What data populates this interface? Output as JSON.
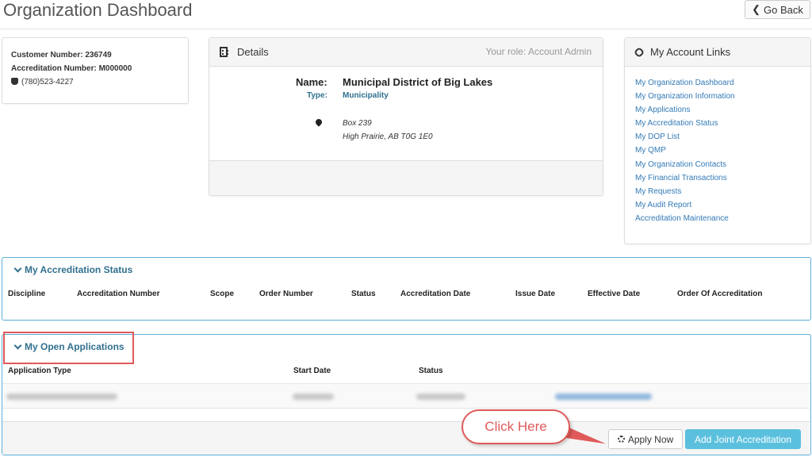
{
  "page": {
    "title": "Organization Dashboard",
    "back_label": "Go Back"
  },
  "customer": {
    "customer_number_label": "Customer Number:",
    "customer_number": "236749",
    "accreditation_number_label": "Accreditation Number:",
    "accreditation_number": "M000000",
    "phone": "(780)523-4227"
  },
  "details": {
    "header": "Details",
    "role": "Your role: Account Admin",
    "name_label": "Name:",
    "name": "Municipal District of Big Lakes",
    "type_label": "Type:",
    "type": "Municipality",
    "address_line1": "Box 239",
    "address_line2": "High Prairie, AB T0G 1E0"
  },
  "account_links": {
    "header": "My Account Links",
    "items": [
      "My Organization Dashboard",
      "My Organization Information",
      "My Applications",
      "My Accreditation Status",
      "My DOP List",
      "My QMP",
      "My Organization Contacts",
      "My Financial Transactions",
      "My Requests",
      "My Audit Report",
      "Accreditation Maintenance"
    ]
  },
  "accreditation_status": {
    "title": "My Accreditation Status",
    "columns": [
      "Discipline",
      "Accreditation Number",
      "Scope",
      "Order Number",
      "Status",
      "Accreditation Date",
      "Issue Date",
      "Effective Date",
      "Order Of Accreditation"
    ]
  },
  "open_applications": {
    "title": "My Open Applications",
    "columns": [
      "Application Type",
      "Start Date",
      "Status"
    ],
    "apply_label": "Apply Now",
    "joint_label": "Add Joint Accreditation"
  },
  "callout": {
    "text": "Click Here"
  },
  "colors": {
    "link": "#337ab7",
    "panel_border": "#5bafd8",
    "panel_title": "#31708f",
    "callout": "#e05a5a",
    "joint_button": "#5bc0de"
  },
  "icons": {
    "back": "chevron-left-icon",
    "details": "building-icon",
    "links": "link-icon",
    "phone": "phone-icon",
    "address": "map-marker-icon",
    "apply": "gear-icon"
  }
}
